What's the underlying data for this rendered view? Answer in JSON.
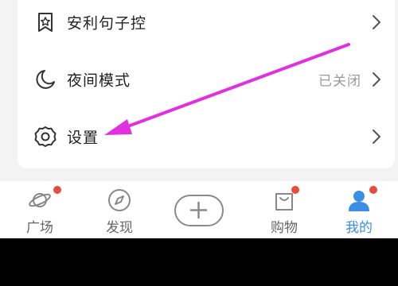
{
  "menu": {
    "items": [
      {
        "label": "安利句子控",
        "value": "",
        "icon": "quote-star-icon"
      },
      {
        "label": "夜间模式",
        "value": "已关闭",
        "icon": "moon-icon"
      },
      {
        "label": "设置",
        "value": "",
        "icon": "gear-icon"
      }
    ]
  },
  "tabbar": {
    "tabs": [
      {
        "label": "广场",
        "icon": "planet-icon",
        "badge": true
      },
      {
        "label": "发现",
        "icon": "compass-icon",
        "badge": false
      },
      {
        "label": "",
        "icon": "plus-icon",
        "badge": false
      },
      {
        "label": "购物",
        "icon": "shopping-bag-icon",
        "badge": true
      },
      {
        "label": "我的",
        "icon": "profile-icon",
        "badge": true,
        "active": true
      }
    ]
  },
  "colors": {
    "accent": "#3a8ee6",
    "badge": "#e94b3c",
    "annotation_arrow": "#e030e0",
    "text_primary": "#222222",
    "text_secondary": "#9a9a9a"
  }
}
